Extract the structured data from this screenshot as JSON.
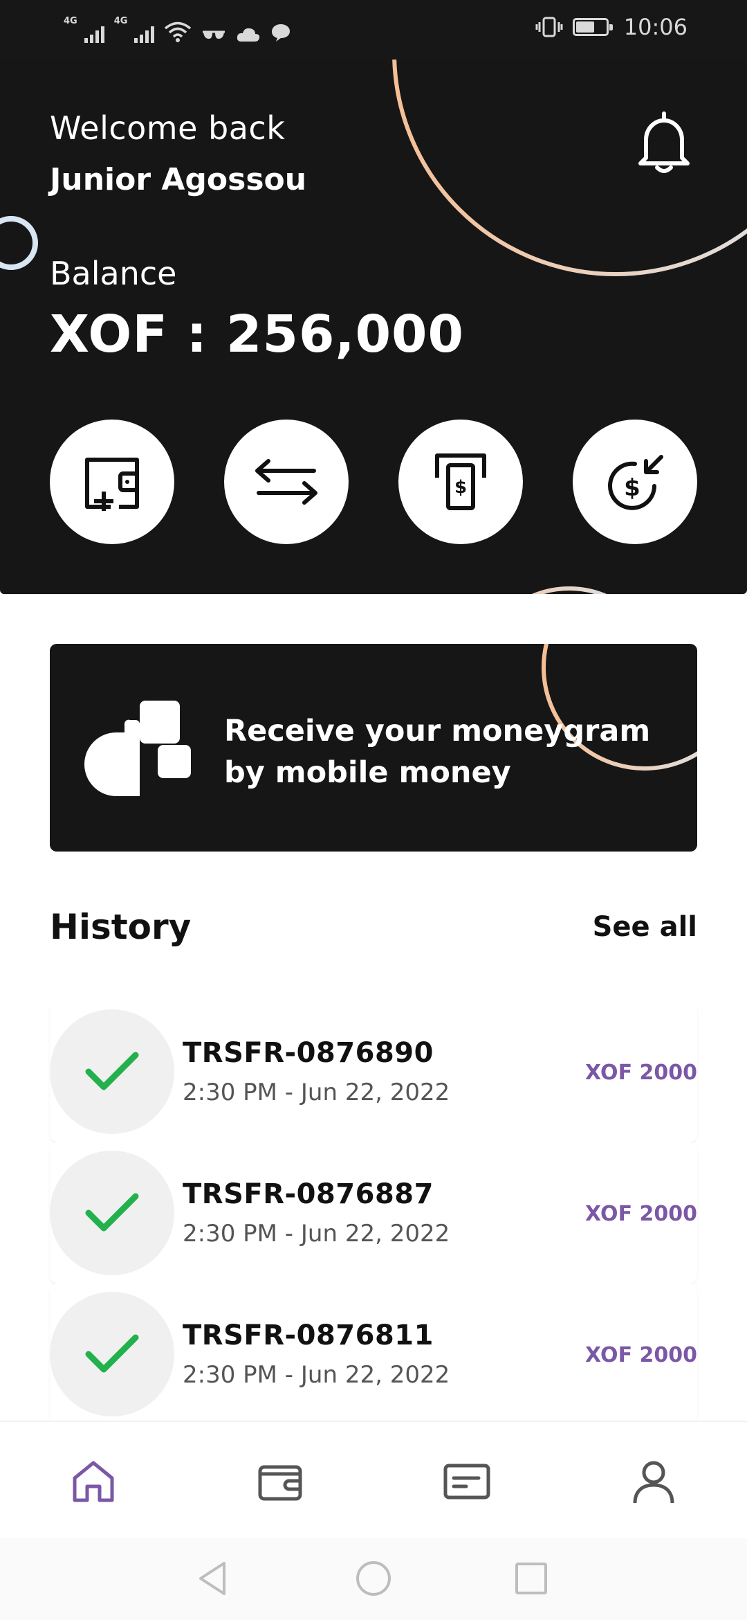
{
  "status_bar": {
    "network_1": "4G",
    "network_2": "4G",
    "time": "10:06"
  },
  "header": {
    "welcome": "Welcome back",
    "user_name": "Junior Agossou",
    "balance_label": "Balance",
    "balance_value": "XOF : 256,000"
  },
  "actions": [
    {
      "icon": "wallet-add-icon"
    },
    {
      "icon": "transfer-arrows-icon"
    },
    {
      "icon": "atm-withdraw-icon"
    },
    {
      "icon": "receive-money-icon"
    }
  ],
  "promo": {
    "line1": "Receive your moneygram",
    "line2": "by mobile money"
  },
  "history": {
    "title": "History",
    "see_all": "See all",
    "items": [
      {
        "id": "TRSFR-0876890",
        "time": "2:30 PM - Jun 22, 2022",
        "amount": "XOF 2000",
        "status": "success"
      },
      {
        "id": "TRSFR-0876887",
        "time": "2:30 PM - Jun 22, 2022",
        "amount": "XOF 2000",
        "status": "success"
      },
      {
        "id": "TRSFR-0876811",
        "time": "2:30 PM - Jun 22, 2022",
        "amount": "XOF 2000",
        "status": "success"
      }
    ]
  },
  "bottom_nav": [
    {
      "icon": "home-icon",
      "active": true
    },
    {
      "icon": "wallet-icon",
      "active": false
    },
    {
      "icon": "card-icon",
      "active": false
    },
    {
      "icon": "profile-icon",
      "active": false
    }
  ],
  "colors": {
    "dark": "#161616",
    "accent_purple": "#7b57a6",
    "success_green": "#22b14c",
    "ring_peach": "#f4c3a0",
    "ring_blue": "#dce9f5"
  }
}
